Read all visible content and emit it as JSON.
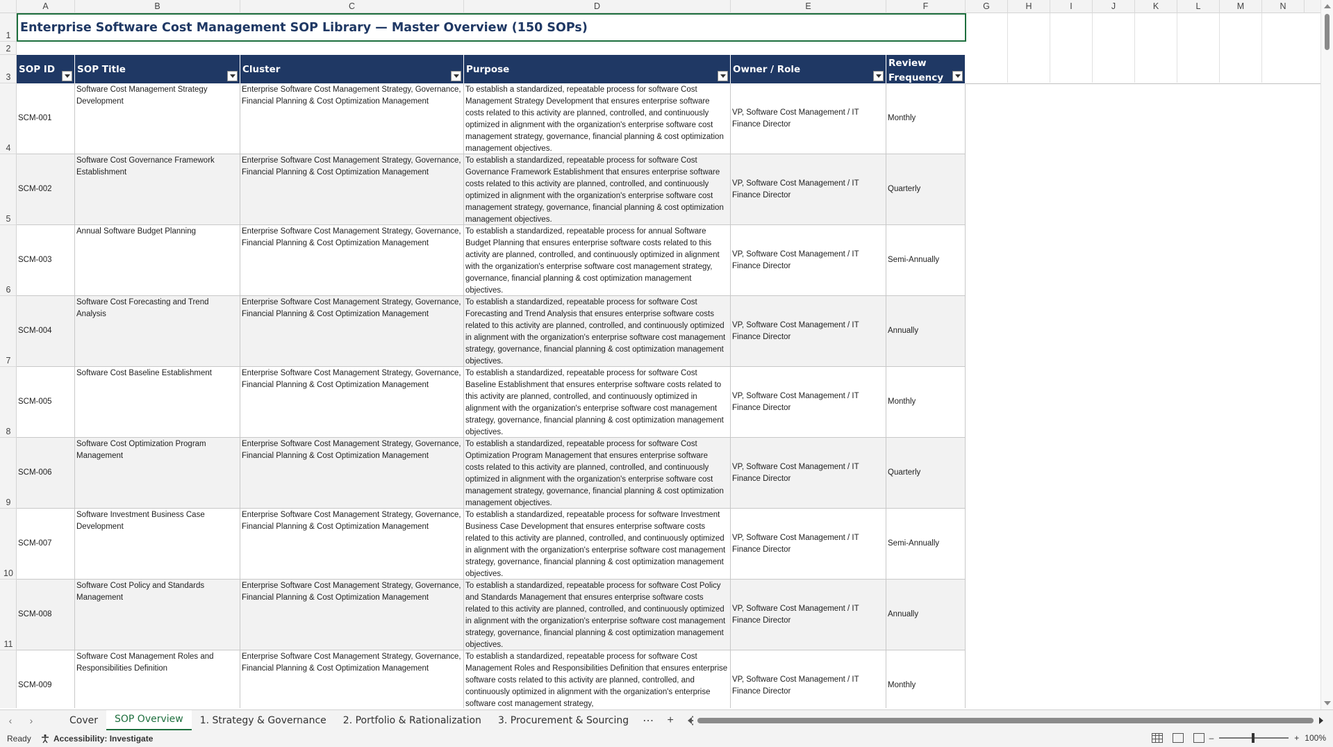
{
  "columns": [
    "A",
    "B",
    "C",
    "D",
    "E",
    "F",
    "G",
    "H",
    "I",
    "J",
    "K",
    "L",
    "M",
    "N"
  ],
  "rows": [
    "1",
    "2",
    "3",
    "4",
    "5",
    "6",
    "7",
    "8",
    "9",
    "10",
    "11"
  ],
  "title": "Enterprise Software Cost Management SOP Library — Master Overview (150 SOPs)",
  "table": {
    "headers": [
      "SOP ID",
      "SOP Title",
      "Cluster",
      "Purpose",
      "Owner / Role",
      "Review Frequency"
    ],
    "rows": [
      {
        "id": "SCM-001",
        "title": "Software Cost Management Strategy Development",
        "cluster": "Enterprise Software Cost Management Strategy, Governance, Financial Planning & Cost Optimization Management",
        "purpose": "To establish a standardized, repeatable process for software Cost Management Strategy Development that ensures enterprise software costs related to this activity are planned, controlled, and continuously optimized in alignment with the organization's enterprise software cost management strategy, governance, financial planning & cost optimization management objectives.",
        "owner": "VP, Software Cost Management / IT Finance Director",
        "freq": "Monthly"
      },
      {
        "id": "SCM-002",
        "title": "Software Cost Governance Framework Establishment",
        "cluster": "Enterprise Software Cost Management Strategy, Governance, Financial Planning & Cost Optimization Management",
        "purpose": "To establish a standardized, repeatable process for software Cost Governance Framework Establishment that ensures enterprise software costs related to this activity are planned, controlled, and continuously optimized in alignment with the organization's enterprise software cost management strategy, governance, financial planning & cost optimization management objectives.",
        "owner": "VP, Software Cost Management / IT Finance Director",
        "freq": "Quarterly"
      },
      {
        "id": "SCM-003",
        "title": "Annual Software Budget Planning",
        "cluster": "Enterprise Software Cost Management Strategy, Governance, Financial Planning & Cost Optimization Management",
        "purpose": "To establish a standardized, repeatable process for annual Software Budget Planning that ensures enterprise software costs related to this activity are planned, controlled, and continuously optimized in alignment with the organization's enterprise software cost management strategy, governance, financial planning & cost optimization management objectives.",
        "owner": "VP, Software Cost Management / IT Finance Director",
        "freq": "Semi-Annually"
      },
      {
        "id": "SCM-004",
        "title": "Software Cost Forecasting and Trend Analysis",
        "cluster": "Enterprise Software Cost Management Strategy, Governance, Financial Planning & Cost Optimization Management",
        "purpose": "To establish a standardized, repeatable process for software Cost Forecasting and Trend Analysis that ensures enterprise software costs related to this activity are planned, controlled, and continuously optimized in alignment with the organization's enterprise software cost management strategy, governance, financial planning & cost optimization management objectives.",
        "owner": "VP, Software Cost Management / IT Finance Director",
        "freq": "Annually"
      },
      {
        "id": "SCM-005",
        "title": "Software Cost Baseline Establishment",
        "cluster": "Enterprise Software Cost Management Strategy, Governance, Financial Planning & Cost Optimization Management",
        "purpose": "To establish a standardized, repeatable process for software Cost Baseline Establishment that ensures enterprise software costs related to this activity are planned, controlled, and continuously optimized in alignment with the organization's enterprise software cost management strategy, governance, financial planning & cost optimization management objectives.",
        "owner": "VP, Software Cost Management / IT Finance Director",
        "freq": "Monthly"
      },
      {
        "id": "SCM-006",
        "title": "Software Cost Optimization Program Management",
        "cluster": "Enterprise Software Cost Management Strategy, Governance, Financial Planning & Cost Optimization Management",
        "purpose": "To establish a standardized, repeatable process for software Cost Optimization Program Management that ensures enterprise software costs related to this activity are planned, controlled, and continuously optimized in alignment with the organization's enterprise software cost management strategy, governance, financial planning & cost optimization management objectives.",
        "owner": "VP, Software Cost Management / IT Finance Director",
        "freq": "Quarterly"
      },
      {
        "id": "SCM-007",
        "title": "Software Investment Business Case Development",
        "cluster": "Enterprise Software Cost Management Strategy, Governance, Financial Planning & Cost Optimization Management",
        "purpose": "To establish a standardized, repeatable process for software Investment Business Case Development that ensures enterprise software costs related to this activity are planned, controlled, and continuously optimized in alignment with the organization's enterprise software cost management strategy, governance, financial planning & cost optimization management objectives.",
        "owner": "VP, Software Cost Management / IT Finance Director",
        "freq": "Semi-Annually"
      },
      {
        "id": "SCM-008",
        "title": "Software Cost Policy and Standards Management",
        "cluster": "Enterprise Software Cost Management Strategy, Governance, Financial Planning & Cost Optimization Management",
        "purpose": "To establish a standardized, repeatable process for software Cost Policy and Standards Management that ensures enterprise software costs related to this activity are planned, controlled, and continuously optimized in alignment with the organization's enterprise software cost management strategy, governance, financial planning & cost optimization management objectives.",
        "owner": "VP, Software Cost Management / IT Finance Director",
        "freq": "Annually"
      },
      {
        "id": "SCM-009",
        "title": "Software Cost Management Roles and Responsibilities Definition",
        "cluster": "Enterprise Software Cost Management Strategy, Governance, Financial Planning & Cost Optimization Management",
        "purpose": "To establish a standardized, repeatable process for software Cost Management Roles and Responsibilities Definition that ensures enterprise software costs related to this activity are planned, controlled, and continuously optimized in alignment with the organization's enterprise software cost management strategy,",
        "owner": "VP, Software Cost Management / IT Finance Director",
        "freq": "Monthly"
      }
    ]
  },
  "tabs": [
    "Cover",
    "SOP Overview",
    "1. Strategy & Governance",
    "2. Portfolio & Rationalization",
    "3. Procurement & Sourcing"
  ],
  "active_tab": "SOP Overview",
  "status": {
    "ready": "Ready",
    "accessibility": "Accessibility: Investigate",
    "zoom": "100%"
  },
  "colors": {
    "header_bg": "#1f3864",
    "accent": "#1e6f3e",
    "alt_row": "#f2f2f2"
  }
}
